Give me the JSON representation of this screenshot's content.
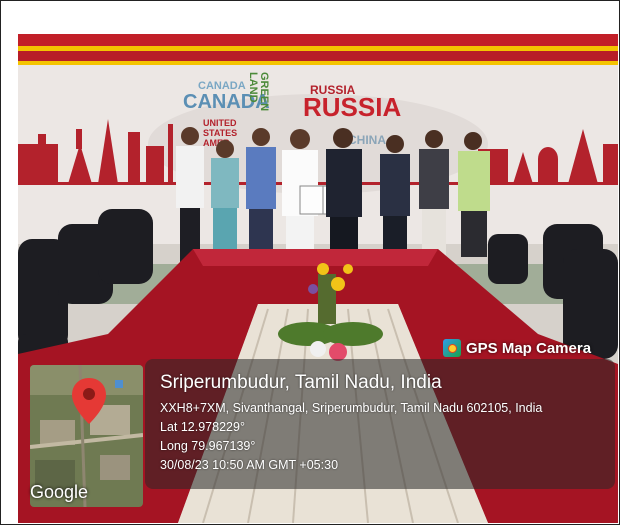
{
  "overlay": {
    "app_tag": "GPS Map Camera",
    "place": "Sriperumbudur, Tamil Nadu, India",
    "address": "XXH8+7XM, Sivanthangal, Sriperumbudur, Tamil Nadu 602105, India",
    "lat": "Lat 12.978229°",
    "long": "Long 79.967139°",
    "datetime": "30/08/23 10:50 AM GMT +05:30",
    "map_brand": "Google"
  },
  "wall": {
    "words": [
      "CANADA",
      "CANADA",
      "GREEN LAND",
      "RUSSIA",
      "UNITED STATES AMERICA",
      "CHINA"
    ]
  },
  "colors": {
    "wall_red": "#b3222c",
    "table_red": "#9d1020",
    "pin_red": "#e53935"
  },
  "icons": [
    "gps-camera-icon",
    "location-pin-icon"
  ]
}
